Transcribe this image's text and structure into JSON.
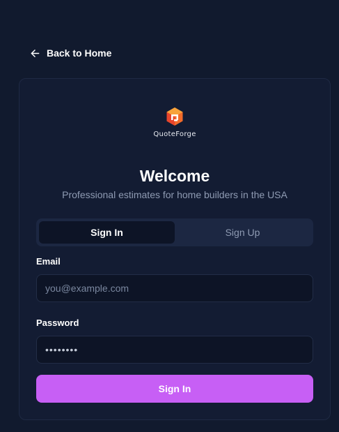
{
  "nav": {
    "back_label": "Back to Home",
    "back_icon": "arrow-left-icon"
  },
  "brand": {
    "logo_icon": "quoteforge-logo-icon",
    "name": "QuoteForge",
    "colors": [
      "#f7a33b",
      "#f26b2a",
      "#e8452c"
    ]
  },
  "header": {
    "title": "Welcome",
    "subtitle": "Professional estimates for home builders in the USA"
  },
  "tabs": [
    {
      "label": "Sign In",
      "active": true
    },
    {
      "label": "Sign Up",
      "active": false
    }
  ],
  "form": {
    "email_label": "Email",
    "email_placeholder": "you@example.com",
    "email_value": "",
    "password_label": "Password",
    "password_value": "••••••••",
    "submit_label": "Sign In"
  },
  "colors": {
    "background": "#111a2e",
    "card": "#131c33",
    "accent": "#c75ff5",
    "muted_text": "#8f9bb3"
  }
}
